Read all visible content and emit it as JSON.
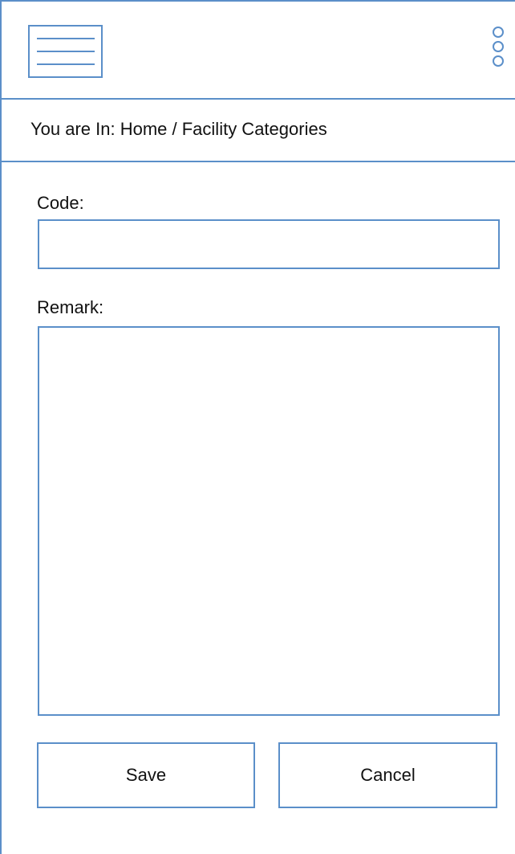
{
  "header": {
    "menu_icon": "hamburger-menu-icon",
    "more_icon": "vertical-dots-icon"
  },
  "breadcrumb": {
    "text": "You are In: Home / Facility Categories"
  },
  "form": {
    "code_label": "Code:",
    "code_value": "",
    "remark_label": "Remark:",
    "remark_value": ""
  },
  "actions": {
    "save_label": "Save",
    "cancel_label": "Cancel"
  },
  "colors": {
    "accent": "#5b8fc9",
    "background": "#ffffff"
  }
}
